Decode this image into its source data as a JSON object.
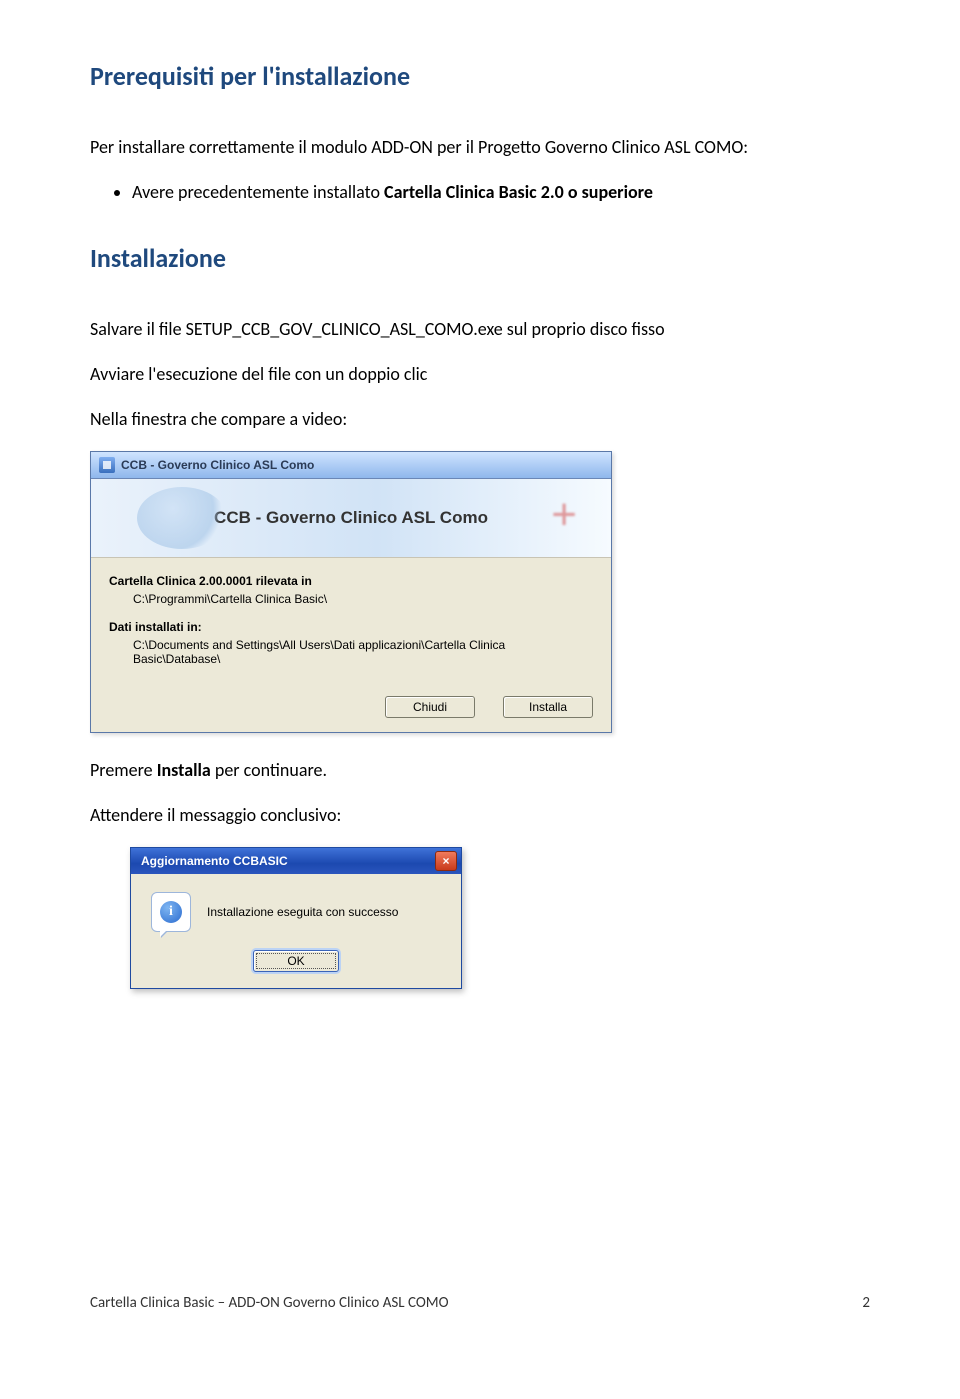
{
  "headings": {
    "prereq": "Prerequisiti per l'installazione",
    "install": "Installazione"
  },
  "paragraphs": {
    "p1": "Per installare correttamente il modulo ADD-ON per il Progetto Governo Clinico ASL COMO:",
    "bullet1_pre": "Avere precedentemente installato ",
    "bullet1_bold": "Cartella Clinica Basic 2.0 o superiore",
    "p2": "Salvare il file SETUP_CCB_GOV_CLINICO_ASL_COMO.exe sul proprio disco fisso",
    "p3": "Avviare l'esecuzione del file con un doppio clic",
    "p4": "Nella finestra che compare a video:",
    "p5_pre": "Premere ",
    "p5_bold": "Installa",
    "p5_post": " per continuare.",
    "p6": "Attendere il messaggio conclusivo:"
  },
  "dialog1": {
    "title": "CCB - Governo Clinico ASL Como",
    "banner_title": "CCB - Governo Clinico ASL Como",
    "detected_label": "Cartella Clinica 2.00.0001 rilevata in",
    "detected_path": "C:\\Programmi\\Cartella Clinica Basic\\",
    "data_label": "Dati installati in:",
    "data_path": "C:\\Documents and Settings\\All Users\\Dati applicazioni\\Cartella Clinica Basic\\Database\\",
    "btn_close": "Chiudi",
    "btn_install": "Installa"
  },
  "dialog2": {
    "title": "Aggiornamento CCBASIC",
    "message": "Installazione eseguita con successo",
    "btn_ok": "OK"
  },
  "footer": {
    "left": "Cartella Clinica Basic – ADD-ON Governo Clinico ASL COMO",
    "page": "2"
  }
}
